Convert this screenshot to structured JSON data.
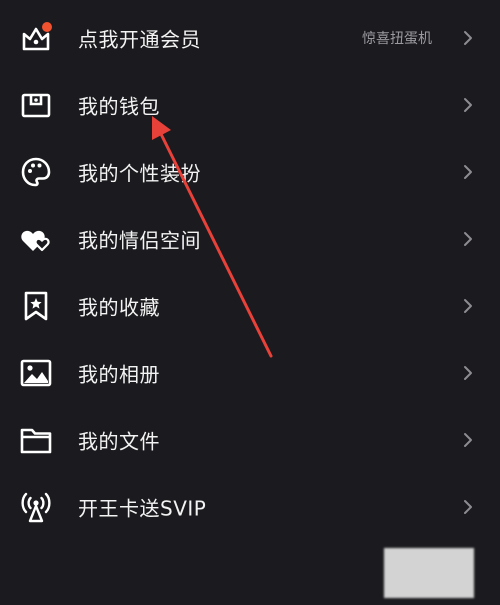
{
  "menu": {
    "items": [
      {
        "label": "点我开通会员",
        "extra": "惊喜扭蛋机",
        "icon": "crown-icon"
      },
      {
        "label": "我的钱包",
        "icon": "wallet-icon"
      },
      {
        "label": "我的个性装扮",
        "icon": "palette-icon"
      },
      {
        "label": "我的情侣空间",
        "icon": "hearts-icon"
      },
      {
        "label": "我的收藏",
        "icon": "bookmark-star-icon"
      },
      {
        "label": "我的相册",
        "icon": "image-icon"
      },
      {
        "label": "我的文件",
        "icon": "folder-icon"
      },
      {
        "label": "开王卡送SVIP",
        "icon": "signal-tower-icon"
      }
    ]
  },
  "colors": {
    "background": "#1b1b1f",
    "text": "#f3f3f3",
    "secondary_text": "#9a9aa0",
    "badge": "#f0522f",
    "annotation_arrow": "#e8413a"
  }
}
